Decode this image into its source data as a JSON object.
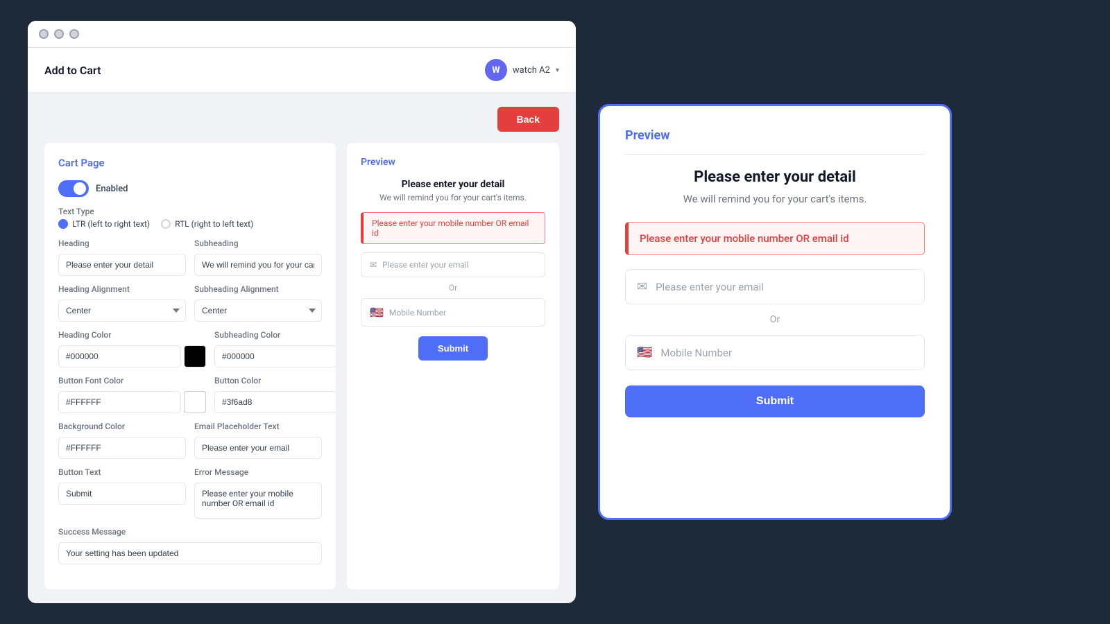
{
  "app": {
    "title": "Add to Cart",
    "user": {
      "initial": "W",
      "name": "watch A2",
      "chevron": "▾"
    }
  },
  "toolbar": {
    "back_label": "Back"
  },
  "settings": {
    "panel_title": "Cart Page",
    "toggle_label": "Enabled",
    "text_type_label": "Text Type",
    "ltr_label": "LTR (left to right text)",
    "rtl_label": "RTL (right to left text)",
    "heading_label": "Heading",
    "heading_value": "Please enter your detail",
    "subheading_label": "Subheading",
    "subheading_value": "We will remind you for your cart's items.",
    "heading_alignment_label": "Heading Alignment",
    "heading_alignment_value": "Center",
    "subheading_alignment_label": "Subheading Alignment",
    "subheading_alignment_value": "Center",
    "heading_color_label": "Heading Color",
    "heading_color_value": "#000000",
    "subheading_color_label": "Subheading Color",
    "subheading_color_value": "#000000",
    "button_font_color_label": "Button Font Color",
    "button_font_color_value": "#FFFFFF",
    "button_color_label": "Button Color",
    "button_color_value": "#3f6ad8",
    "background_color_label": "Background Color",
    "background_color_value": "#FFFFFF",
    "email_placeholder_label": "Email Placeholder Text",
    "email_placeholder_value": "Please enter your email",
    "button_text_label": "Button Text",
    "button_text_value": "Submit",
    "error_message_label": "Error Message",
    "error_message_value": "Please enter your mobile number OR email id",
    "success_message_label": "Success Message",
    "success_message_value": "Your setting has been updated"
  },
  "preview_small": {
    "title": "Preview",
    "heading": "Please enter your detail",
    "subheading": "We will remind you for your cart's items.",
    "error_text": "Please enter your mobile number OR email id",
    "email_placeholder": "Please enter your email",
    "or_text": "Or",
    "phone_placeholder": "Mobile Number",
    "flag": "🇺🇸",
    "submit_label": "Submit"
  },
  "preview_large": {
    "title": "Preview",
    "heading": "Please enter your detail",
    "subheading": "We will remind you for your cart's items.",
    "error_text": "Please enter your mobile number OR email id",
    "email_placeholder": "Please enter your email",
    "or_text": "Or",
    "phone_placeholder": "Mobile Number",
    "flag": "🇺🇸",
    "submit_label": "Submit"
  },
  "colors": {
    "black_swatch": "#000000",
    "blue_swatch": "#3f6ad8",
    "white_swatch": "#FFFFFF"
  }
}
